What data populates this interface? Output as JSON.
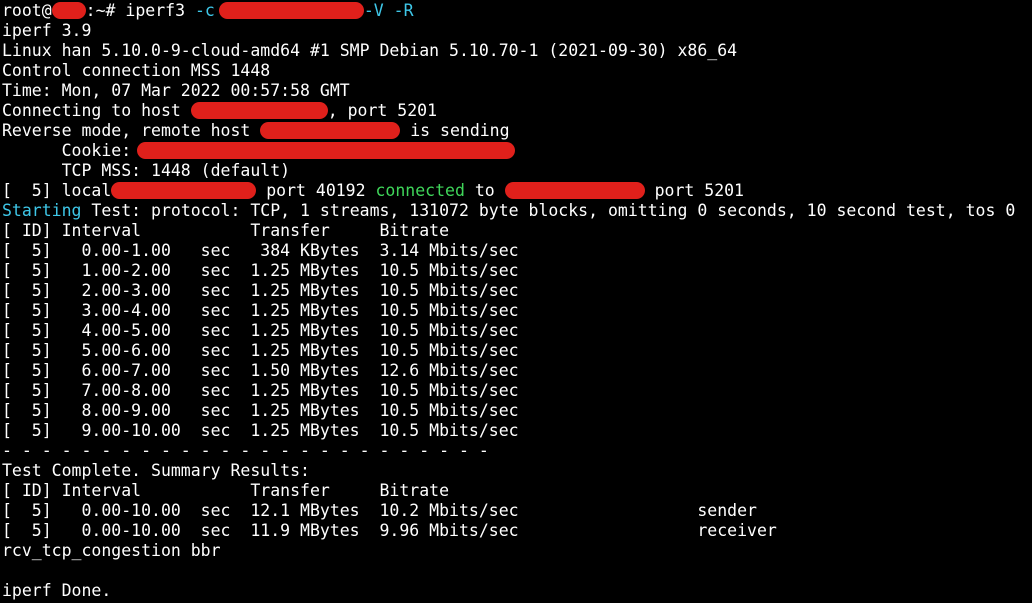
{
  "colors": {
    "background": "#000000",
    "foreground": "#ffffff",
    "cyan": "#3ec7e8",
    "green": "#3fd65a",
    "redaction": "#e0201b"
  },
  "prompt": {
    "user": "root@",
    "path_sep": ":~# ",
    "command": "iperf3 ",
    "flag_c": "-c",
    "flags": "-V -R"
  },
  "header_lines": [
    "iperf 3.9",
    "Linux han 5.10.0-9-cloud-amd64 #1 SMP Debian 5.10.70-1 (2021-09-30) x86_64",
    "Control connection MSS 1448",
    "Time: Mon, 07 Mar 2022 00:57:58 GMT"
  ],
  "connecting": {
    "prefix": "Connecting to host ",
    "suffix": ", port 5201"
  },
  "reverse": {
    "prefix": "Reverse mode, remote host ",
    "suffix": " is sending"
  },
  "cookie": {
    "label": "      Cookie: "
  },
  "tcp_mss": "      TCP MSS: 1448 (default)",
  "local_line": {
    "prefix": "[  5] local",
    "port": " port 40192 ",
    "connected": "connected",
    "to": " to ",
    "remote_port": " port 5201"
  },
  "starting": {
    "word": "Starting",
    "rest": " Test: protocol: TCP, 1 streams, 131072 byte blocks, omitting 0 seconds, 10 second test, tos 0"
  },
  "interval_header": "[ ID] Interval           Transfer     Bitrate",
  "intervals": [
    "[  5]   0.00-1.00   sec   384 KBytes  3.14 Mbits/sec",
    "[  5]   1.00-2.00   sec  1.25 MBytes  10.5 Mbits/sec",
    "[  5]   2.00-3.00   sec  1.25 MBytes  10.5 Mbits/sec",
    "[  5]   3.00-4.00   sec  1.25 MBytes  10.5 Mbits/sec",
    "[  5]   4.00-5.00   sec  1.25 MBytes  10.5 Mbits/sec",
    "[  5]   5.00-6.00   sec  1.25 MBytes  10.5 Mbits/sec",
    "[  5]   6.00-7.00   sec  1.50 MBytes  12.6 Mbits/sec",
    "[  5]   7.00-8.00   sec  1.25 MBytes  10.5 Mbits/sec",
    "[  5]   8.00-9.00   sec  1.25 MBytes  10.5 Mbits/sec",
    "[  5]   9.00-10.00  sec  1.25 MBytes  10.5 Mbits/sec"
  ],
  "separator": "- - - - - - - - - - - - - - - - - - - - - - - - -",
  "summary_title": "Test Complete. Summary Results:",
  "summary_header": "[ ID] Interval           Transfer     Bitrate",
  "summary": [
    "[  5]   0.00-10.00  sec  12.1 MBytes  10.2 Mbits/sec                  sender",
    "[  5]   0.00-10.00  sec  11.9 MBytes  9.96 Mbits/sec                  receiver"
  ],
  "congestion": "rcv_tcp_congestion bbr",
  "blank": "",
  "done": "iperf Done."
}
